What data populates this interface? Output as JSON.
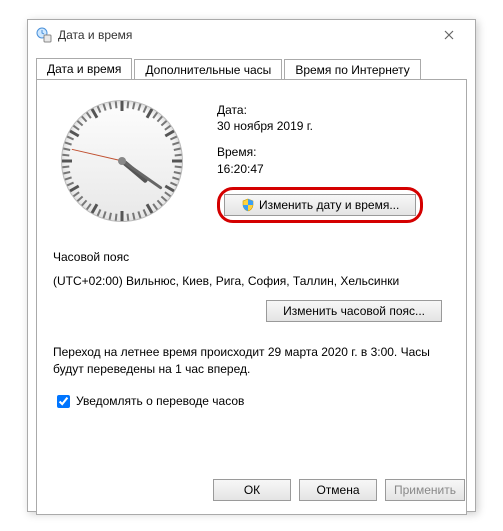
{
  "window": {
    "title": "Дата и время"
  },
  "tabs": {
    "t0": "Дата и время",
    "t1": "Дополнительные часы",
    "t2": "Время по Интернету"
  },
  "main": {
    "date_label": "Дата:",
    "date_value": "30 ноября 2019 г.",
    "time_label": "Время:",
    "time_value": "16:20:47",
    "change_dt_button": "Изменить дату и время..."
  },
  "tz": {
    "section_label": "Часовой пояс",
    "value": "(UTC+02:00) Вильнюс, Киев, Рига, София, Таллин, Хельсинки",
    "change_button": "Изменить часовой пояс..."
  },
  "dst": {
    "note": "Переход на летнее время происходит 29 марта 2020 г. в 3:00. Часы будут переведены на 1 час вперед.",
    "notify_label": "Уведомлять о переводе часов"
  },
  "footer": {
    "ok": "ОК",
    "cancel": "Отмена",
    "apply": "Применить"
  }
}
